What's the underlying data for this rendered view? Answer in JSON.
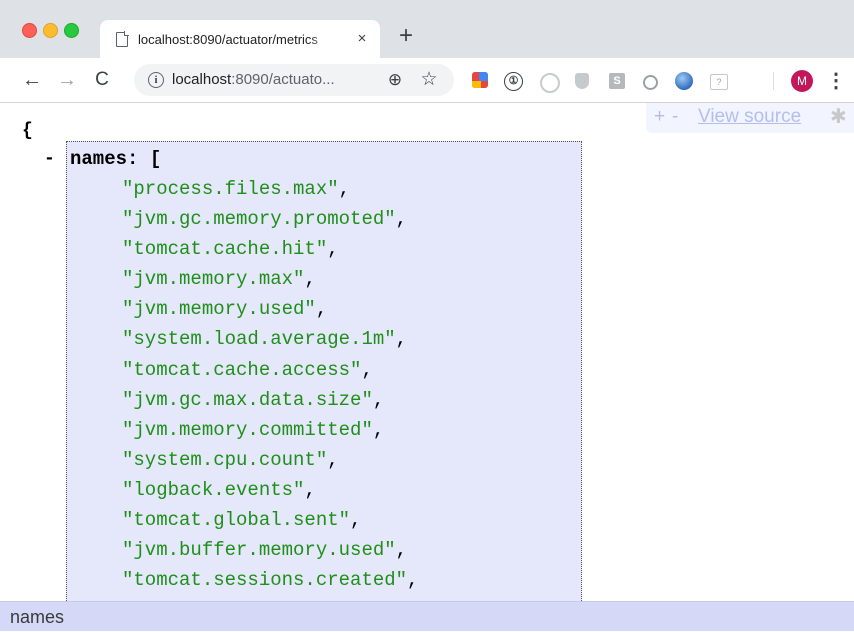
{
  "browser": {
    "tab": {
      "title": "localhost:8090/actuator/metrics",
      "close_icon": "×"
    },
    "new_tab_icon": "+",
    "nav": {
      "back_icon": "←",
      "forward_icon": "→",
      "reload_icon": "C"
    },
    "address_bar": {
      "host": "localhost",
      "rest": ":8090/actuato...",
      "info_icon": "i",
      "zoom_icon": "⊕",
      "star_icon": "☆"
    },
    "extensions": [
      {
        "name": "colorful-extension-icon"
      },
      {
        "name": "1password-icon",
        "glyph": "①"
      },
      {
        "name": "circle-extension-icon"
      },
      {
        "name": "shield-extension-icon"
      },
      {
        "name": "s-extension-icon",
        "glyph": "S"
      },
      {
        "name": "ring-extension-icon"
      },
      {
        "name": "globe-extension-icon"
      },
      {
        "name": "square-extension-icon",
        "glyph": "?"
      }
    ],
    "avatar_letter": "M",
    "menu_icon": "⋮"
  },
  "json_viewer": {
    "toolbar": {
      "plus": "+",
      "minus": "-",
      "view_source": "View source",
      "gear_icon": "✱"
    },
    "open_brace": "{",
    "collapser": "-",
    "key": "names",
    "key_suffix": ": [",
    "items": [
      "\"process.files.max\"",
      "\"jvm.gc.memory.promoted\"",
      "\"tomcat.cache.hit\"",
      "\"jvm.memory.max\"",
      "\"jvm.memory.used\"",
      "\"system.load.average.1m\"",
      "\"tomcat.cache.access\"",
      "\"jvm.gc.max.data.size\"",
      "\"jvm.memory.committed\"",
      "\"system.cpu.count\"",
      "\"logback.events\"",
      "\"tomcat.global.sent\"",
      "\"jvm.buffer.memory.used\"",
      "\"tomcat.sessions.created\""
    ],
    "item_separator": ","
  },
  "status_bar": {
    "path": "names"
  }
}
